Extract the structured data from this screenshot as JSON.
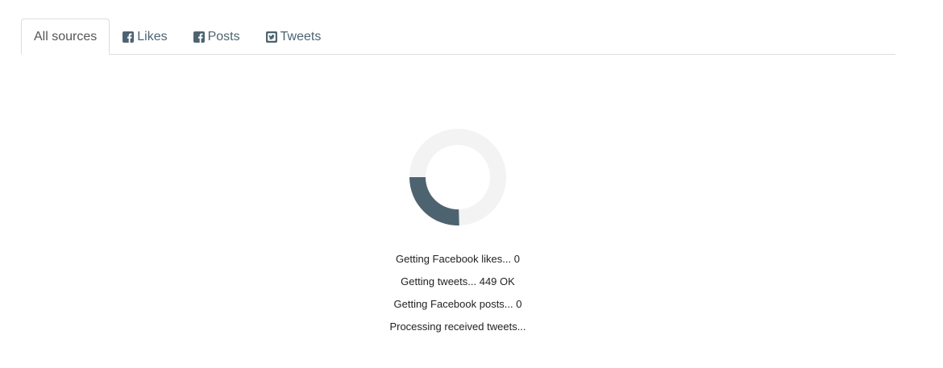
{
  "tabs": [
    {
      "label": "All sources",
      "icon": null,
      "active": true
    },
    {
      "label": "Likes",
      "icon": "facebook-square-icon",
      "active": false
    },
    {
      "label": "Posts",
      "icon": "facebook-square-icon",
      "active": false
    },
    {
      "label": "Tweets",
      "icon": "twitter-square-icon",
      "active": false
    }
  ],
  "colors": {
    "accent": "#4e6370",
    "spinner_track": "#f3f3f3",
    "spinner_arc": "#4e6370"
  },
  "status": [
    "Getting Facebook likes... 0",
    "Getting tweets... 449 OK",
    "Getting Facebook posts... 0",
    "Processing received tweets..."
  ]
}
